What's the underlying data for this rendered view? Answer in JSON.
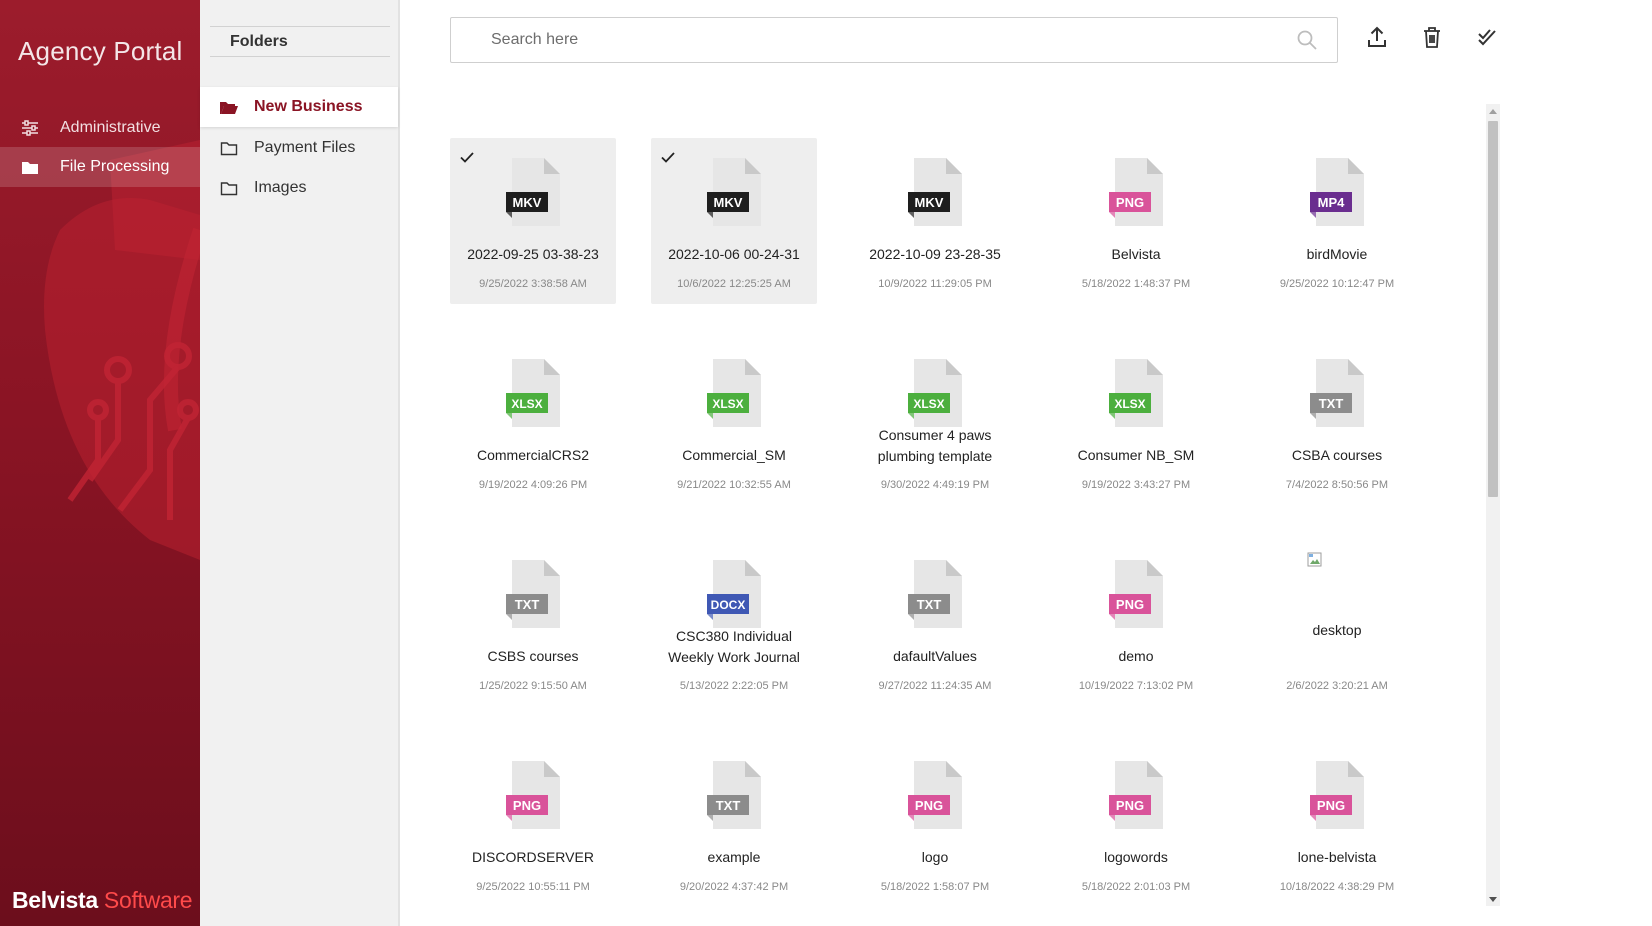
{
  "app": {
    "title": "Agency Portal"
  },
  "nav": {
    "items": [
      {
        "label": "Administrative",
        "icon": "sliders-icon"
      },
      {
        "label": "File Processing",
        "icon": "folder-icon",
        "active": true
      }
    ]
  },
  "brand": {
    "word1": "Belvista",
    "word2": "Software",
    "accent_color": "#ff4a4a"
  },
  "folders": {
    "header": "Folders",
    "items": [
      {
        "label": "New Business",
        "active": true
      },
      {
        "label": "Payment Files"
      },
      {
        "label": "Images"
      }
    ]
  },
  "search": {
    "placeholder": "Search here",
    "value": ""
  },
  "toolbar": {
    "upload_icon": "upload-icon",
    "delete_icon": "trash-icon",
    "select_icon": "check-all-icon"
  },
  "files": [
    {
      "name": "2022-09-25 03-38-23",
      "date": "9/25/2022 3:38:58 AM",
      "type": "MKV",
      "selected": true
    },
    {
      "name": "2022-10-06 00-24-31",
      "date": "10/6/2022 12:25:25 AM",
      "type": "MKV",
      "selected": true
    },
    {
      "name": "2022-10-09 23-28-35",
      "date": "10/9/2022 11:29:05 PM",
      "type": "MKV"
    },
    {
      "name": "Belvista",
      "date": "5/18/2022 1:48:37 PM",
      "type": "PNG"
    },
    {
      "name": "birdMovie",
      "date": "9/25/2022 10:12:47 PM",
      "type": "MP4"
    },
    {
      "name": "CommercialCRS2",
      "date": "9/19/2022 4:09:26 PM",
      "type": "XLSX"
    },
    {
      "name": "Commercial_SM",
      "date": "9/21/2022 10:32:55 AM",
      "type": "XLSX"
    },
    {
      "name": "Consumer 4 paws plumbing template",
      "date": "9/30/2022 4:49:19 PM",
      "type": "XLSX"
    },
    {
      "name": "Consumer NB_SM",
      "date": "9/19/2022 3:43:27 PM",
      "type": "XLSX"
    },
    {
      "name": "CSBA courses",
      "date": "7/4/2022 8:50:56 PM",
      "type": "TXT"
    },
    {
      "name": "CSBS courses",
      "date": "1/25/2022 9:15:50 AM",
      "type": "TXT"
    },
    {
      "name": "CSC380 Individual Weekly Work Journal",
      "date": "5/13/2022 2:22:05 PM",
      "type": "DOCX"
    },
    {
      "name": "dafaultValues",
      "date": "9/27/2022 11:24:35 AM",
      "type": "TXT"
    },
    {
      "name": "demo",
      "date": "10/19/2022 7:13:02 PM",
      "type": "PNG"
    },
    {
      "name": "desktop",
      "date": "2/6/2022 3:20:21 AM",
      "type": "IMAGE"
    },
    {
      "name": "DISCORDSERVER",
      "date": "9/25/2022 10:55:11 PM",
      "type": "PNG"
    },
    {
      "name": "example",
      "date": "9/20/2022 4:37:42 PM",
      "type": "TXT"
    },
    {
      "name": "logo",
      "date": "5/18/2022 1:58:07 PM",
      "type": "PNG"
    },
    {
      "name": "logowords",
      "date": "5/18/2022 2:01:03 PM",
      "type": "PNG"
    },
    {
      "name": "lone-belvista",
      "date": "10/18/2022 4:38:29 PM",
      "type": "PNG"
    }
  ],
  "type_colors": {
    "MKV": "#1e1e1e",
    "PNG": "#d9539a",
    "MP4": "#6a2d8f",
    "XLSX": "#4caf3e",
    "TXT": "#8c8c8c",
    "DOCX": "#3f58b4"
  },
  "colors": {
    "accent": "#8a1424",
    "selected_tile": "#eeeeee"
  }
}
